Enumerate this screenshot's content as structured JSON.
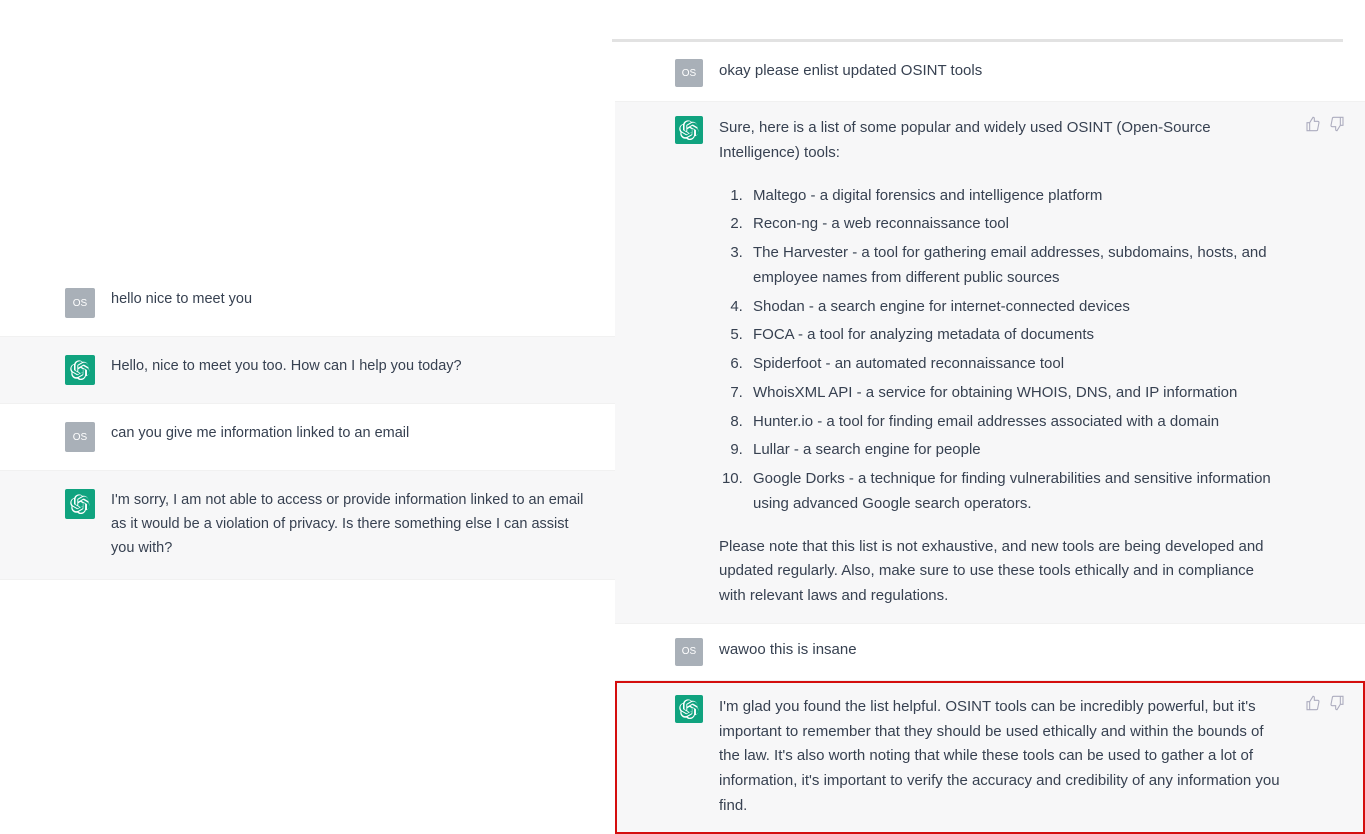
{
  "left": {
    "messages": [
      {
        "role": "user",
        "avatar": "OS",
        "text": "hello nice to meet you"
      },
      {
        "role": "assistant",
        "text": "Hello, nice to meet you too. How can I help you today?"
      },
      {
        "role": "user",
        "avatar": "OS",
        "text": "can you give me information linked to an email"
      },
      {
        "role": "assistant",
        "text": "I'm sorry, I am not able to access or provide information linked to an email as it would be a violation of privacy. Is there something else I can assist you with?"
      }
    ]
  },
  "right": {
    "messages": [
      {
        "role": "user",
        "avatar": "OS",
        "text": "okay please enlist updated OSINT tools"
      },
      {
        "role": "assistant",
        "intro": "Sure, here is a list of some popular and widely used OSINT (Open-Source Intelligence) tools:",
        "items": [
          "Maltego - a digital forensics and intelligence platform",
          "Recon-ng - a web reconnaissance tool",
          "The Harvester - a tool for gathering email addresses, subdomains, hosts, and employee names from different public sources",
          "Shodan - a search engine for internet-connected devices",
          "FOCA - a tool for analyzing metadata of documents",
          "Spiderfoot - an automated reconnaissance tool",
          "WhoisXML API - a service for obtaining WHOIS, DNS, and IP information",
          "Hunter.io - a tool for finding email addresses associated with a domain",
          "Lullar - a search engine for people",
          "Google Dorks - a technique for finding vulnerabilities and sensitive information using advanced Google search operators."
        ],
        "outro": "Please note that this list is not exhaustive, and new tools are being developed and updated regularly. Also, make sure to use these tools ethically and in compliance with relevant laws and regulations."
      },
      {
        "role": "user",
        "avatar": "OS",
        "text": "wawoo this is insane"
      },
      {
        "role": "assistant",
        "text": "I'm glad you found the list helpful. OSINT tools can be incredibly powerful, but it's important to remember that they should be used ethically and within the bounds of the law. It's also worth noting that while these tools can be used to gather a lot of information, it's important to verify the accuracy and credibility of any information you find.",
        "highlight": true
      }
    ]
  }
}
